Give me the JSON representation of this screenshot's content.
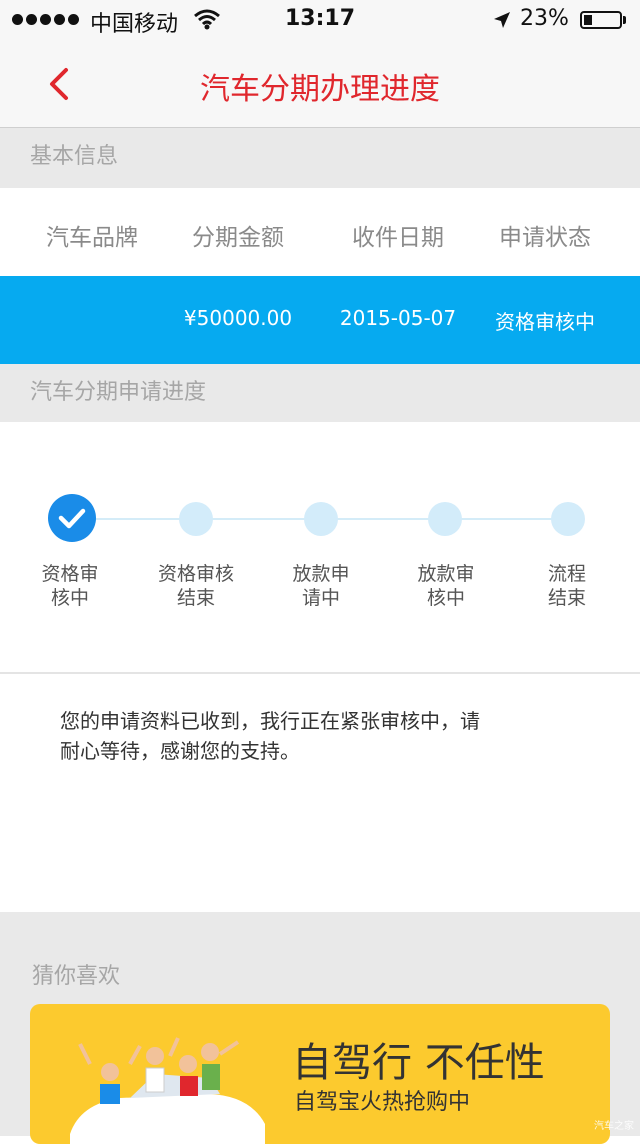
{
  "status_bar": {
    "carrier": "中国移动",
    "time": "13:17",
    "battery_percent": "23%",
    "battery_level": 0.23,
    "icons": [
      "signal-dots-icon",
      "wifi-icon",
      "location-arrow-icon",
      "battery-icon"
    ]
  },
  "nav": {
    "title": "汽车分期办理进度",
    "back_icon": "chevron-left-icon"
  },
  "basic_info": {
    "header": "基本信息",
    "columns": [
      "汽车品牌",
      "分期金额",
      "收件日期",
      "申请状态"
    ],
    "row": {
      "brand": "",
      "amount": "¥50000.00",
      "date": "2015-05-07",
      "status": "资格审核中"
    }
  },
  "progress": {
    "header": "汽车分期申请进度",
    "current_step": 0,
    "steps": [
      {
        "line1": "资格审",
        "line2": "核中"
      },
      {
        "line1": "资格审核",
        "line2": "结束"
      },
      {
        "line1": "放款申",
        "line2": "请中"
      },
      {
        "line1": "放款审",
        "line2": "核中"
      },
      {
        "line1": "流程",
        "line2": "结束"
      }
    ]
  },
  "message": {
    "line1": "您的申请资料已收到，我行正在紧张审核中，请",
    "line2": "耐心等待，感谢您的支持。"
  },
  "recommend": {
    "title": "猜你喜欢",
    "banner_headline": "自驾行 不任性",
    "banner_sub": "自驾宝火热抢购中",
    "watermark": "汽车之家"
  },
  "colors": {
    "accent_red": "#e0272d",
    "info_blue": "#06aaf0",
    "step_active": "#1a8ce8",
    "banner_yellow": "#fcca2e"
  }
}
